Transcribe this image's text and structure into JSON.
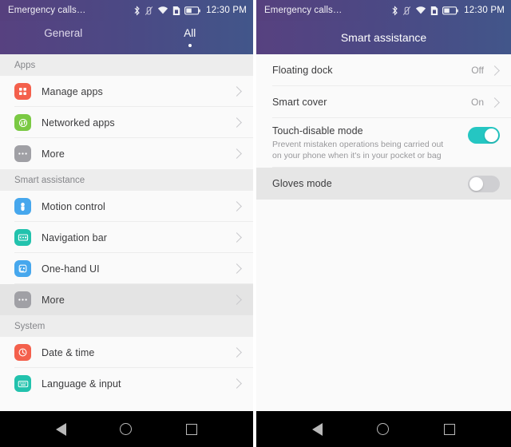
{
  "statusbar": {
    "title": "Emergency calls…",
    "time": "12:30 PM",
    "icons": [
      "bluetooth-icon",
      "vibrate-icon",
      "wifi-icon",
      "sim-card-icon",
      "battery-icon"
    ]
  },
  "colors": {
    "header_gradient_start": "#574180",
    "header_gradient_end": "#42568a",
    "toggle_on": "#25c6c2",
    "toggle_off": "#cfcfd2",
    "selected_row": "#e4e4e4",
    "section_header_bg": "#ededed"
  },
  "left_screen": {
    "tabs": [
      {
        "label": "General",
        "active": false
      },
      {
        "label": "All",
        "active": true
      }
    ],
    "sections": [
      {
        "title": "Apps",
        "items": [
          {
            "label": "Manage apps",
            "icon": "grid-apps-icon",
            "icon_color": "#f4604c",
            "selected": false
          },
          {
            "label": "Networked apps",
            "icon": "network-arrows-icon",
            "icon_color": "#7ac943",
            "selected": false
          },
          {
            "label": "More",
            "icon": "ellipsis-icon",
            "icon_color": "#a0a0a5",
            "selected": false
          }
        ]
      },
      {
        "title": "Smart assistance",
        "items": [
          {
            "label": "Motion control",
            "icon": "hand-gesture-icon",
            "icon_color": "#46a7ed",
            "selected": false
          },
          {
            "label": "Navigation bar",
            "icon": "navigation-bar-icon",
            "icon_color": "#22c2ad",
            "selected": false
          },
          {
            "label": "One-hand UI",
            "icon": "one-hand-icon",
            "icon_color": "#46a7ed",
            "selected": false
          },
          {
            "label": "More",
            "icon": "ellipsis-icon",
            "icon_color": "#a0a0a5",
            "selected": true
          }
        ]
      },
      {
        "title": "System",
        "items": [
          {
            "label": "Date & time",
            "icon": "clock-icon",
            "icon_color": "#f4604c",
            "selected": false
          },
          {
            "label": "Language & input",
            "icon": "keyboard-icon",
            "icon_color": "#22c2ad",
            "selected": false
          }
        ]
      }
    ]
  },
  "right_screen": {
    "title": "Smart assistance",
    "items": [
      {
        "title": "Floating dock",
        "desc": "",
        "value": "Off",
        "control": "chevron",
        "shaded": false
      },
      {
        "title": "Smart cover",
        "desc": "",
        "value": "On",
        "control": "chevron",
        "shaded": false
      },
      {
        "title": "Touch-disable mode",
        "desc": "Prevent mistaken operations being carried out on your phone when it's in your pocket or bag",
        "value": "",
        "control": "toggle-on",
        "shaded": false
      },
      {
        "title": "Gloves mode",
        "desc": "",
        "value": "",
        "control": "toggle-off",
        "shaded": true
      }
    ]
  },
  "navbar": {
    "back": "back-triangle-icon",
    "home": "home-circle-icon",
    "recents": "recents-square-icon"
  }
}
